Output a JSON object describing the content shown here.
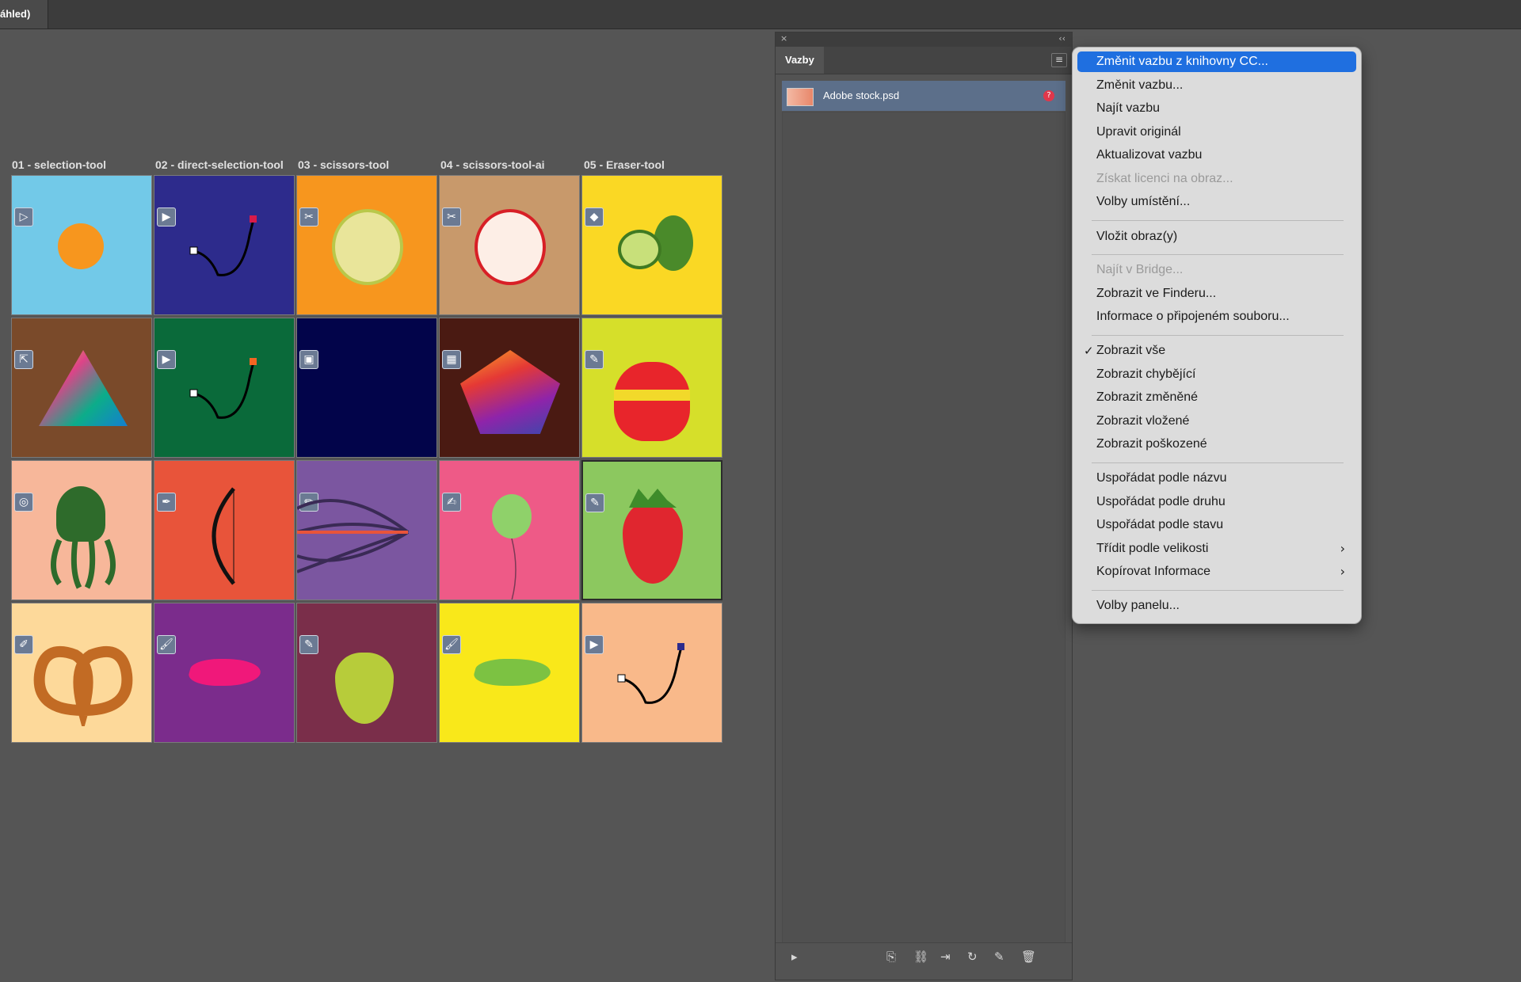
{
  "window": {
    "tab_label": "áhled)"
  },
  "grid": {
    "column_labels": [
      "01 - selection-tool",
      "02 - direct-selection-tool",
      "03 - scissors-tool",
      "04 - scissors-tool-ai",
      "05 - Eraser-tool"
    ]
  },
  "panel": {
    "close_glyph": "×",
    "collapse_glyph": "‹‹",
    "title": "Vazby",
    "menu_glyph": "≡",
    "link_name": "Adobe stock.psd",
    "missing_glyph": "?"
  },
  "menu": {
    "items": [
      {
        "label": "Změnit vazbu z knihovny CC...",
        "state": "selected"
      },
      {
        "label": "Změnit vazbu...",
        "state": "normal"
      },
      {
        "label": "Najít vazbu",
        "state": "normal"
      },
      {
        "label": "Upravit originál",
        "state": "normal"
      },
      {
        "label": "Aktualizovat vazbu",
        "state": "normal"
      },
      {
        "label": "Získat licenci na obraz...",
        "state": "disabled"
      },
      {
        "label": "Volby umístění...",
        "state": "normal"
      },
      {
        "label": "Vložit obraz(y)",
        "state": "normal"
      },
      {
        "label": "Najít v Bridge...",
        "state": "disabled"
      },
      {
        "label": "Zobrazit ve Finderu...",
        "state": "normal"
      },
      {
        "label": "Informace o připojeném souboru...",
        "state": "normal"
      },
      {
        "label": "Zobrazit vše",
        "state": "checked"
      },
      {
        "label": "Zobrazit chybějící",
        "state": "normal"
      },
      {
        "label": "Zobrazit změněné",
        "state": "normal"
      },
      {
        "label": "Zobrazit vložené",
        "state": "normal"
      },
      {
        "label": "Zobrazit poškozené",
        "state": "normal"
      },
      {
        "label": "Uspořádat podle názvu",
        "state": "normal"
      },
      {
        "label": "Uspořádat podle druhu",
        "state": "normal"
      },
      {
        "label": "Uspořádat podle stavu",
        "state": "normal"
      },
      {
        "label": "Třídit podle velikosti",
        "state": "submenu"
      },
      {
        "label": "Kopírovat Informace",
        "state": "submenu"
      },
      {
        "label": "Volby panelu...",
        "state": "normal"
      }
    ],
    "check_glyph": "✓",
    "submenu_glyph": "›"
  },
  "colors": {
    "accent": "#1f6fe0",
    "cells": [
      "#72c9e8",
      "#2d2b8c",
      "#f7961e",
      "#c8996b",
      "#fad824",
      "#7a4a2a",
      "#0a6a3a",
      "#02044a",
      "#4a1a12",
      "#d6df2a",
      "#f7b79a",
      "#e8543a",
      "#7b56a0",
      "#ee5a87",
      "#8cc85f",
      "#fdd99a",
      "#7b2c8c",
      "#7a2e4a",
      "#f9e81a",
      "#f9b98a"
    ]
  }
}
